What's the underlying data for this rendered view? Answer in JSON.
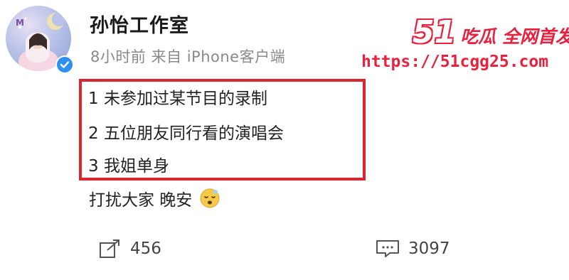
{
  "post": {
    "author": "孙怡工作室",
    "meta": "8小时前 来自 iPhone客户端",
    "lines": [
      "1 未参加过某节目的录制",
      "2 五位朋友同行看的演唱会",
      "3 我姐单身"
    ],
    "closing_text": "打扰大家 晚安",
    "emoji": "sleeping-face-emoji"
  },
  "actions": {
    "repost_count": "456",
    "comment_count": "3097"
  },
  "watermark": {
    "number": "51",
    "tag": "吃瓜 全网首发",
    "url": "https://51cgg25.com"
  },
  "colors": {
    "highlight": "#d9262f",
    "watermark": "#e8213f",
    "verified": "#2f8ff5",
    "meta_text": "#8a8a8a"
  }
}
